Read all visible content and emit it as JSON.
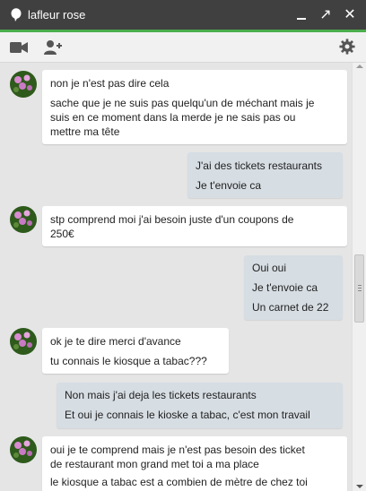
{
  "window": {
    "title": "lafleur rose",
    "accent_color": "#4cae4c",
    "titlebar_color": "#404040",
    "controls": [
      "minimize-icon",
      "popout-icon",
      "close-icon"
    ],
    "close_glyph": "✕",
    "popout_glyph": "↗"
  },
  "toolbar": {
    "icons": [
      "video-call-icon",
      "add-person-icon",
      "settings-gear-icon"
    ]
  },
  "messages": [
    {
      "sender": "contact",
      "lines": [
        "non je n'est pas dire cela"
      ]
    },
    {
      "sender": "contact",
      "lines": [
        "sache que je ne suis pas quelqu'un de méchant mais je",
        "suis en ce moment dans la merde je ne sais pas ou",
        "mettre ma tête"
      ]
    },
    {
      "sender": "me",
      "lines": [
        "J'ai des tickets restaurants",
        "Je t'envoie ca"
      ]
    },
    {
      "sender": "contact",
      "lines": [
        "stp comprend moi j'ai besoin juste d'un coupons de",
        "250€"
      ]
    },
    {
      "sender": "me",
      "lines": [
        "Oui oui",
        "Je t'envoie ca",
        "Un carnet de 22"
      ]
    },
    {
      "sender": "contact",
      "lines": [
        "ok je te dire merci d'avance",
        "tu connais le kiosque a tabac???"
      ]
    },
    {
      "sender": "me",
      "lines": [
        "Non mais j'ai deja les tickets restaurants",
        "Et oui je connais le kioske a tabac, c'est mon travail"
      ]
    },
    {
      "sender": "contact",
      "lines": [
        "oui je te comprend mais je n'est pas besoin des ticket",
        "de restaurant mon grand met toi a ma place",
        "le kiosque a tabac est a combien de mètre de chez toi"
      ]
    }
  ],
  "colors": {
    "incoming_bubble": "#ffffff",
    "outgoing_bubble": "#d6dde3",
    "background": "#e5e5e5"
  }
}
